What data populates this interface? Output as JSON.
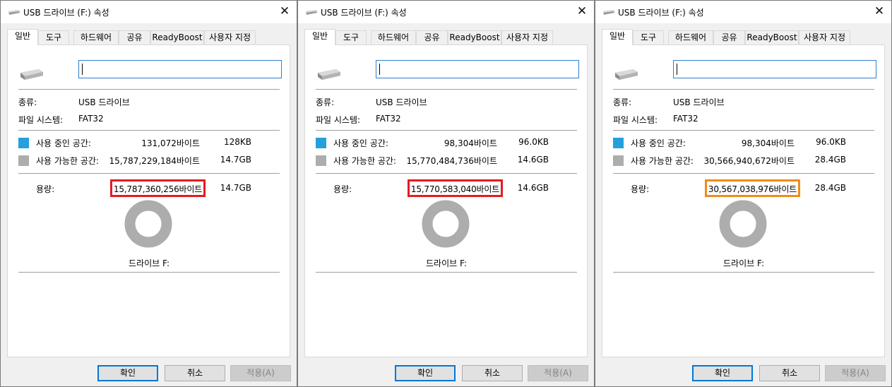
{
  "common": {
    "title": "USB 드라이브 (F:) 속성",
    "close_symbol": "✕",
    "tabs": [
      "일반",
      "도구",
      "하드웨어",
      "공유",
      "ReadyBoost",
      "사용자 지정"
    ],
    "type_label": "종류:",
    "type_value": "USB 드라이브",
    "fs_label": "파일 시스템:",
    "fs_value": "FAT32",
    "used_label": "사용 중인 공간:",
    "free_label": "사용 가능한 공간:",
    "capacity_label": "용량:",
    "drive_label": "드라이브 F:",
    "ok_label": "확인",
    "cancel_label": "취소",
    "apply_label": "적용(A)",
    "name_value": ""
  },
  "colors": {
    "used": "#26a0da",
    "free": "#adadad",
    "highlight_red": "#e31b23",
    "highlight_orange": "#f28a1a",
    "accent": "#0078d7"
  },
  "dialogs": [
    {
      "used_bytes": "131,072바이트",
      "used_size": "128KB",
      "free_bytes": "15,787,229,184바이트",
      "free_size": "14.7GB",
      "capacity_bytes": "15,787,360,256바이트",
      "capacity_size": "14.7GB",
      "highlight_color": "red",
      "used_fraction": 8.3e-06
    },
    {
      "used_bytes": "98,304바이트",
      "used_size": "96.0KB",
      "free_bytes": "15,770,484,736바이트",
      "free_size": "14.6GB",
      "capacity_bytes": "15,770,583,040바이트",
      "capacity_size": "14.6GB",
      "highlight_color": "red",
      "used_fraction": 6.2e-06
    },
    {
      "used_bytes": "98,304바이트",
      "used_size": "96.0KB",
      "free_bytes": "30,566,940,672바이트",
      "free_size": "28.4GB",
      "capacity_bytes": "30,567,038,976바이트",
      "capacity_size": "28.4GB",
      "highlight_color": "orange",
      "used_fraction": 3.2e-06
    }
  ]
}
